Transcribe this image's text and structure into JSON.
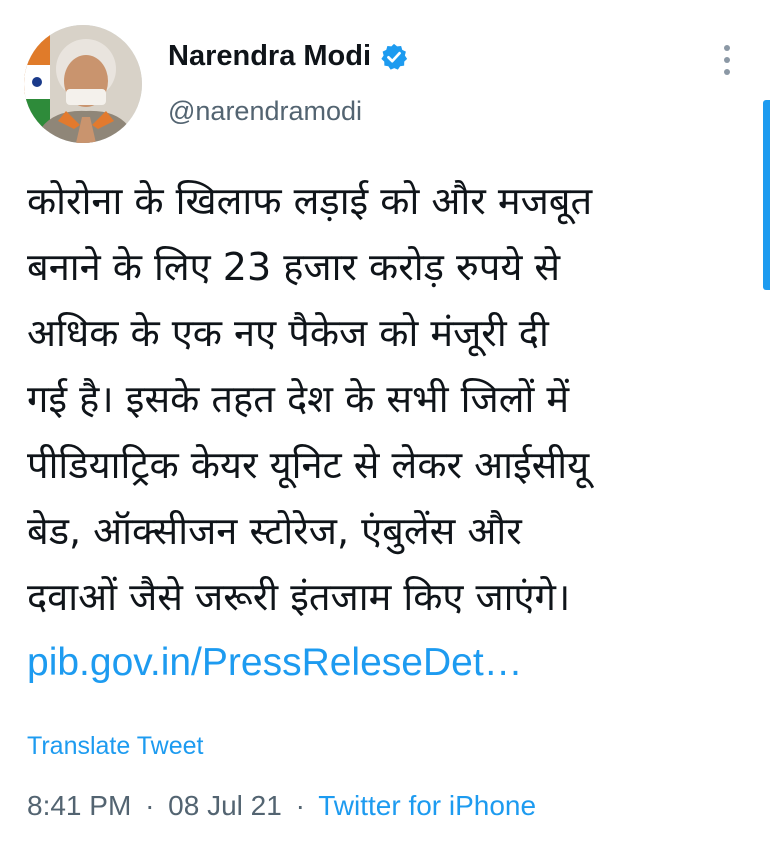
{
  "author": {
    "display_name": "Narendra Modi",
    "handle": "@narendramodi",
    "verified_icon": "verified-badge-icon",
    "avatar_icon": "profile-photo"
  },
  "tweet": {
    "lines": [
      "कोरोना के खिलाफ लड़ाई को और मजबूत",
      "बनाने के लिए 23 हजार करोड़ रुपये से",
      "अधिक के एक नए पैकेज को मंजूरी दी",
      "गई है। इसके तहत देश के सभी जिलों में",
      "पीडियाट्रिक केयर यूनिट से लेकर आईसीयू",
      "बेड, ऑक्सीजन स्टोरेज, एंबुलेंस और",
      "दवाओं जैसे जरूरी इंतजाम किए जाएंगे।"
    ],
    "link": "pib.gov.in/PressReleseDet…",
    "translate_label": "Translate Tweet",
    "time": "8:41 PM",
    "date": "08 Jul 21",
    "separator": "·",
    "source": "Twitter for iPhone"
  },
  "colors": {
    "link": "#1d9bf0",
    "secondary_text": "#536471",
    "primary_text": "#0f1419"
  }
}
